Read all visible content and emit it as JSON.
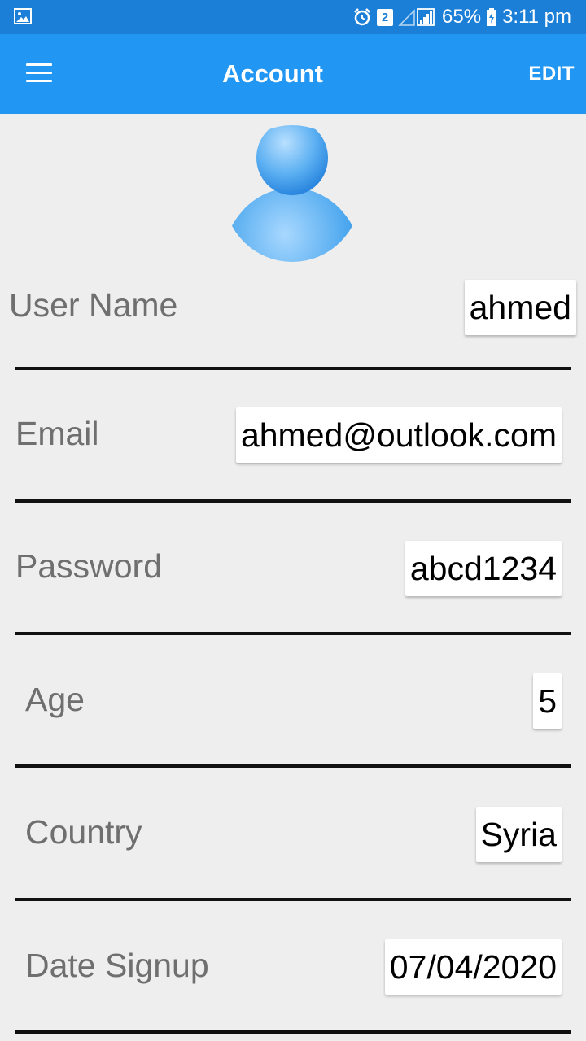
{
  "status_bar": {
    "battery": "65%",
    "time": "3:11 pm",
    "sim_slot": "2",
    "icons": [
      "gallery-icon",
      "alarm-icon",
      "sim-icon",
      "signal-icon",
      "battery-icon"
    ]
  },
  "app_bar": {
    "title": "Account",
    "action": "EDIT",
    "icon": "menu-icon",
    "color": "#2196f3"
  },
  "profile": {
    "avatar_icon": "user-avatar-icon"
  },
  "fields": {
    "username": {
      "label": "User Name",
      "value": "ahmed"
    },
    "email": {
      "label": "Email",
      "value": "ahmed@outlook.com"
    },
    "password": {
      "label": "Password",
      "value": "abcd1234"
    },
    "age": {
      "label": "Age",
      "value": "5"
    },
    "country": {
      "label": "Country",
      "value": "Syria"
    },
    "date_signup": {
      "label": "Date Signup",
      "value": "07/04/2020"
    }
  }
}
